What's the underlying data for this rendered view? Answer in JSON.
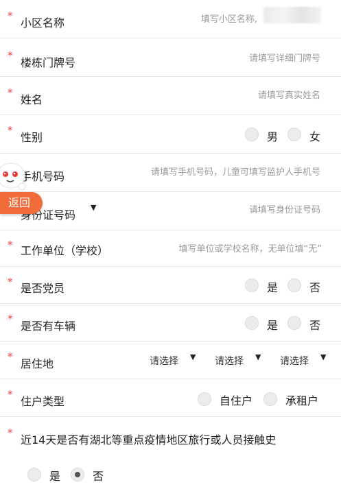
{
  "form": {
    "community": {
      "label": "小区名称",
      "placeholder": "填写小区名称,"
    },
    "building": {
      "label": "楼栋门牌号",
      "placeholder": "请填写详细门牌号"
    },
    "name": {
      "label": "姓名",
      "placeholder": "请填写真实姓名"
    },
    "gender": {
      "label": "性别",
      "options": [
        "男",
        "女"
      ],
      "selected": null
    },
    "phone": {
      "label": "手机号码",
      "placeholder": "请填写手机号码，儿童可填写监护人手机号"
    },
    "id_card": {
      "label": "身份证号码",
      "placeholder": "请填写身份证号码"
    },
    "work": {
      "label": "工作单位（学校）",
      "placeholder": "填写单位或学校名称，无单位填“无”"
    },
    "party": {
      "label": "是否党员",
      "options": [
        "是",
        "否"
      ],
      "selected": null
    },
    "vehicle": {
      "label": "是否有车辆",
      "options": [
        "是",
        "否"
      ],
      "selected": null
    },
    "residence": {
      "label": "居住地",
      "selects": [
        "请选择",
        "请选择",
        "请选择"
      ]
    },
    "household": {
      "label": "住户类型",
      "options": [
        "自住户",
        "承租户"
      ],
      "selected": null
    },
    "travel": {
      "label": "近14天是否有湖北等重点疫情地区旅行或人员接触史",
      "options": [
        "是",
        "否"
      ],
      "selected": "否"
    }
  },
  "required_mark": "*",
  "dropdown_caret": "▼",
  "back_button": {
    "label": "返回"
  },
  "colors": {
    "required": "#e53935",
    "back_button": "#f26b3a",
    "placeholder": "#9a9a9a"
  },
  "icons": {
    "mascot": "mascot-icon",
    "radio": "radio-icon",
    "caret": "caret-down-icon"
  }
}
